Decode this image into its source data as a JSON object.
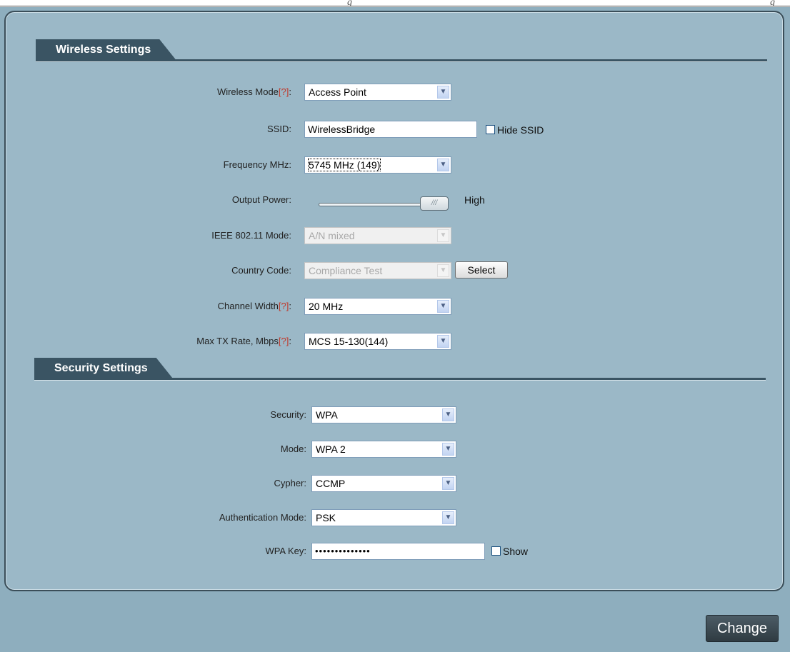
{
  "doc_header": {
    "left_fragment": "g",
    "right_fragment": "g"
  },
  "wireless": {
    "section_title": "Wireless Settings",
    "help_marker": "[?]",
    "mode": {
      "label": "Wireless Mode",
      "value": "Access Point"
    },
    "ssid": {
      "label": "SSID:",
      "value": "WirelessBridge",
      "hide_label": "Hide SSID",
      "hide_checked": false
    },
    "frequency": {
      "label": "Frequency MHz:",
      "value": "5745 MHz (149)"
    },
    "output_power": {
      "label": "Output Power:",
      "thumb_text": "///",
      "value_text": "High",
      "level": 1.0
    },
    "ieee_mode": {
      "label": "IEEE 802.11 Mode:",
      "value": "A/N mixed",
      "disabled": true
    },
    "country": {
      "label": "Country Code:",
      "value": "Compliance Test",
      "disabled": true,
      "select_button": "Select"
    },
    "channel_width": {
      "label": "Channel Width",
      "value": "20 MHz"
    },
    "max_tx": {
      "label": "Max TX Rate, Mbps",
      "value": "MCS 15-130(144)"
    }
  },
  "security": {
    "section_title": "Security Settings",
    "security": {
      "label": "Security:",
      "value": "WPA"
    },
    "mode": {
      "label": "Mode:",
      "value": "WPA 2"
    },
    "cypher": {
      "label": "Cypher:",
      "value": "CCMP"
    },
    "auth_mode": {
      "label": "Authentication Mode:",
      "value": "PSK"
    },
    "wpa_key": {
      "label": "WPA Key:",
      "value": "••••••••••••••",
      "show_label": "Show",
      "show_checked": false
    }
  },
  "footer": {
    "change_button": "Change"
  },
  "colors": {
    "section_tab": "#3a5463",
    "panel": "#9bb8c7",
    "frame": "#8eaebe",
    "help": "#c0392b"
  }
}
